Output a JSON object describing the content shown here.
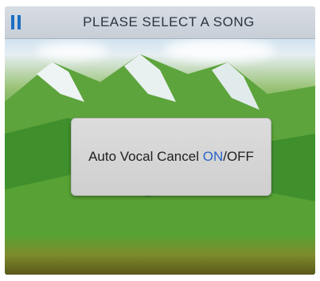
{
  "header": {
    "icon": "pause-icon",
    "title": "PLEASE SELECT A SONG"
  },
  "dialog": {
    "prefix": "Auto Vocal Cancel ",
    "on_label": "ON",
    "separator_off": "/OFF"
  },
  "colors": {
    "accent": "#1e6fc4",
    "on_highlight": "#2a63c8"
  }
}
